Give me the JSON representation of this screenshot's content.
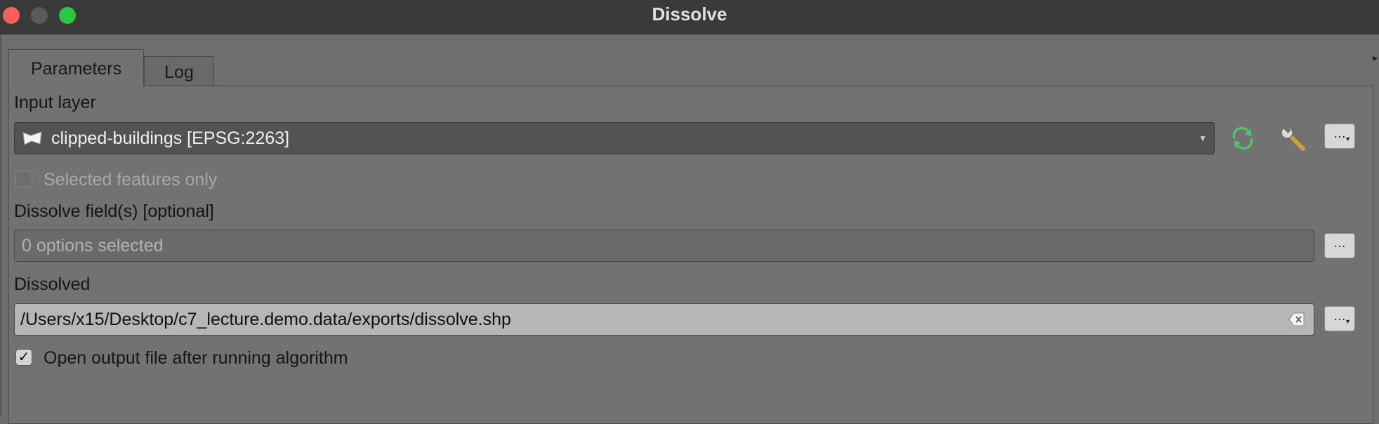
{
  "window": {
    "title": "Dissolve"
  },
  "tabs": [
    {
      "label": "Parameters"
    },
    {
      "label": "Log"
    }
  ],
  "input_layer": {
    "label": "Input layer",
    "value": "clipped-buildings [EPSG:2263]"
  },
  "selected_only": {
    "label": "Selected features only",
    "checked": false,
    "enabled": false
  },
  "dissolve_fields": {
    "label": "Dissolve field(s) [optional]",
    "placeholder": "0 options selected"
  },
  "dissolved": {
    "label": "Dissolved",
    "value": "/Users/x15/Desktop/c7_lecture.demo.data/exports/dissolve.shp"
  },
  "open_output": {
    "label": "Open output file after running algorithm",
    "checked": true
  },
  "browse_label": "…",
  "check_mark": "✓",
  "colors": {
    "refresh_icon": "#4fc26a",
    "titlebar": "#3a3a3a",
    "panel": "#727272"
  }
}
